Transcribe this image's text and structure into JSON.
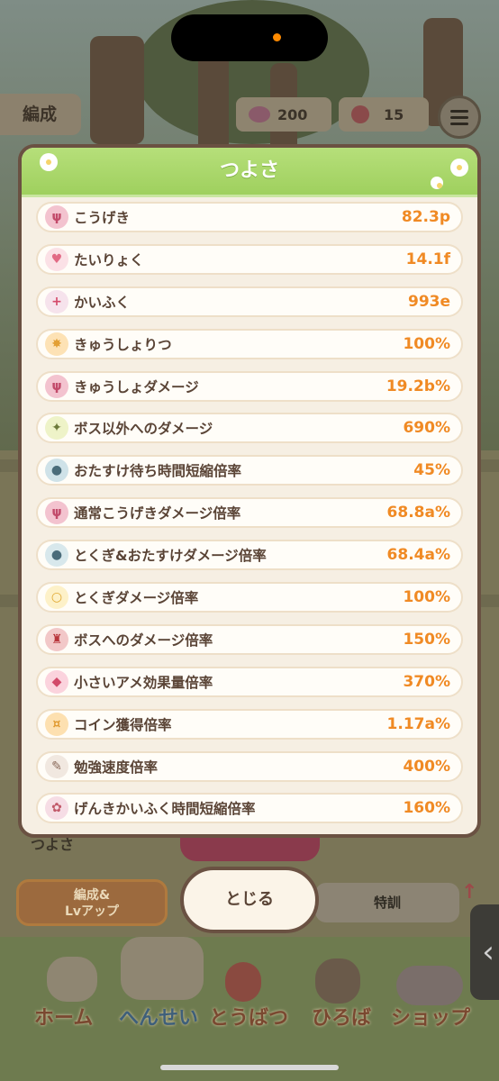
{
  "hud": {
    "formation_tab": "編成",
    "currency1": {
      "icon": "candy-icon",
      "value": "200"
    },
    "currency2": {
      "icon": "lollipop-icon",
      "value": "15"
    }
  },
  "background": {
    "stats_label": "つよさ",
    "tab_left": "編成&\nLvアップ",
    "tab_right": "特訓"
  },
  "nav": [
    {
      "label": "ホーム",
      "icon": "house-icon"
    },
    {
      "label": "へんせい",
      "icon": "characters-icon",
      "active": true
    },
    {
      "label": "とうばつ",
      "icon": "fork-icon"
    },
    {
      "label": "ひろば",
      "icon": "signpost-icon"
    },
    {
      "label": "ショップ",
      "icon": "shop-icon"
    }
  ],
  "modal": {
    "title": "つよさ",
    "stats": [
      {
        "label": "こうげき",
        "value": "82.3p",
        "icon": "attack-icon"
      },
      {
        "label": "たいりょく",
        "value": "14.1f",
        "icon": "heart-icon"
      },
      {
        "label": "かいふく",
        "value": "993e",
        "icon": "heal-icon"
      },
      {
        "label": "きゅうしょりつ",
        "value": "100%",
        "icon": "crit-rate-icon"
      },
      {
        "label": "きゅうしょダメージ",
        "value": "19.2b%",
        "icon": "crit-damage-icon"
      },
      {
        "label": "ボス以外へのダメージ",
        "value": "690%",
        "icon": "non-boss-icon"
      },
      {
        "label": "おたすけ待ち時間短縮倍率",
        "value": "45%",
        "icon": "helper-wait-icon"
      },
      {
        "label": "通常こうげきダメージ倍率",
        "value": "68.8a%",
        "icon": "normal-attack-icon"
      },
      {
        "label": "とくぎ&おたすけダメージ倍率",
        "value": "68.4a%",
        "icon": "skill-helper-icon"
      },
      {
        "label": "とくぎダメージ倍率",
        "value": "100%",
        "icon": "skill-icon"
      },
      {
        "label": "ボスへのダメージ倍率",
        "value": "150%",
        "icon": "boss-icon"
      },
      {
        "label": "小さいアメ効果量倍率",
        "value": "370%",
        "icon": "small-candy-icon"
      },
      {
        "label": "コイン獲得倍率",
        "value": "1.17a%",
        "icon": "coin-icon"
      },
      {
        "label": "勉強速度倍率",
        "value": "400%",
        "icon": "study-icon"
      },
      {
        "label": "げんきかいふく時間短縮倍率",
        "value": "160%",
        "icon": "stamina-icon"
      }
    ],
    "close_label": "とじる"
  },
  "colors": {
    "header_green": "#9fd05e",
    "value_orange": "#f08a24",
    "label_brown": "#5a4436",
    "frame_brown": "#6a5142"
  }
}
